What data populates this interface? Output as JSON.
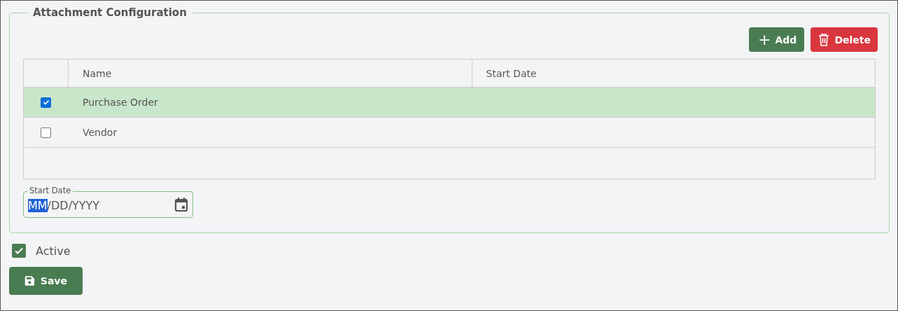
{
  "section": {
    "title": "Attachment Configuration"
  },
  "toolbar": {
    "buttons": [
      {
        "kind": "add",
        "icon": "+",
        "label": "Add"
      },
      {
        "kind": "delete",
        "label": "Delete"
      }
    ]
  },
  "table": {
    "columns": [
      "Name",
      "Start Date"
    ],
    "rows": [
      {
        "name": "Purchase Order",
        "start_date": "",
        "selected": true
      },
      {
        "name": "Vendor",
        "start_date": "",
        "selected": false
      }
    ]
  },
  "start_date_field": {
    "label": "Start Date",
    "segments": [
      {
        "text": "MM",
        "selected": true
      },
      {
        "text": "/DD/YYYY",
        "selected": false
      }
    ]
  },
  "active": {
    "label": "Active",
    "checked": true
  },
  "save_button": {
    "label": "Save"
  }
}
